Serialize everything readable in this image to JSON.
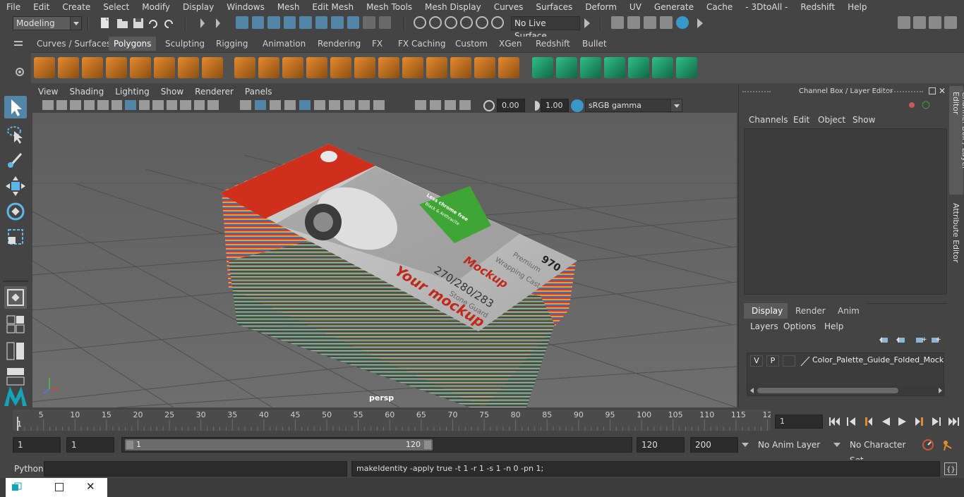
{
  "menubar": {
    "items": [
      "File",
      "Edit",
      "Create",
      "Select",
      "Modify",
      "Display",
      "Windows",
      "Mesh",
      "Edit Mesh",
      "Mesh Tools",
      "Mesh Display",
      "Curves",
      "Surfaces",
      "Deform",
      "UV",
      "Generate",
      "Cache",
      "- 3DtoAll -",
      "Redshift",
      "Help"
    ]
  },
  "statusline": {
    "mode": "Modeling",
    "live_surface": "No Live Surface"
  },
  "shelf": {
    "tabs": [
      "Curves / Surfaces",
      "Polygons",
      "Sculpting",
      "Rigging",
      "Animation",
      "Rendering",
      "FX",
      "FX Caching",
      "Custom",
      "XGen",
      "Redshift",
      "Bullet"
    ],
    "active": "Polygons"
  },
  "panel": {
    "menus": [
      "View",
      "Shading",
      "Lighting",
      "Show",
      "Renderer",
      "Panels"
    ],
    "exposure": "0.00",
    "gamma": "1.00",
    "color_space": "sRGB gamma",
    "camera_label": "persp"
  },
  "model_text": {
    "number": "970",
    "line1": "Premium",
    "line2": "Wrapping Cast",
    "brand": "Mockup",
    "codes": "270/280/283",
    "line3": "Stone Guard",
    "big_brand": "Your mockup",
    "badge1": "Less chrome free",
    "badge2": "Black & Anthracite"
  },
  "channelbox": {
    "title": "Channel Box / Layer Editor",
    "menus": [
      "Channels",
      "Edit",
      "Object",
      "Show"
    ],
    "layer_tabs": [
      "Display",
      "Render",
      "Anim"
    ],
    "active_layer_tab": "Display",
    "layer_menus": [
      "Layers",
      "Options",
      "Help"
    ],
    "layer": {
      "v": "V",
      "p": "P",
      "name": "Color_Palette_Guide_Folded_Mockup"
    },
    "side_tabs": [
      "Channel Box / Layer Editor",
      "Attribute Editor"
    ]
  },
  "timeline": {
    "ticks": [
      "5",
      "10",
      "15",
      "20",
      "25",
      "30",
      "35",
      "40",
      "45",
      "50",
      "55",
      "60",
      "65",
      "70",
      "75",
      "80",
      "85",
      "90",
      "95",
      "100",
      "105",
      "110",
      "115",
      "12"
    ],
    "start_label": "1",
    "current_frame": "1"
  },
  "range": {
    "start": "1",
    "inner_start": "1",
    "slider_start": "1",
    "slider_end": "120",
    "end": "120",
    "outer_end": "200",
    "anim_layer": "No Anim Layer",
    "character_set": "No Character Set"
  },
  "cmdline": {
    "lang": "Python",
    "output": "makeIdentity -apply true -t 1 -r 1 -s 1 -n 0 -pn 1;"
  },
  "colors": {
    "accent": "#5285a6",
    "shelf_green": "#1f9e6d",
    "shelf_orange": "#e58a2c",
    "card_red": "#d0321f"
  }
}
